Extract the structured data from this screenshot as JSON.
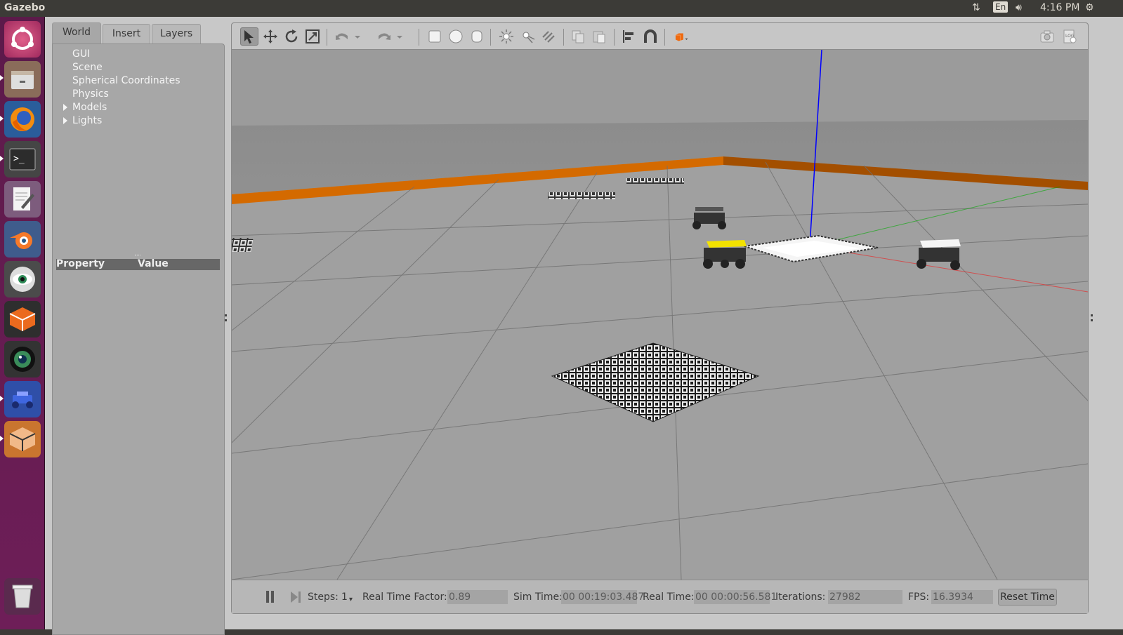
{
  "app": {
    "title": "Gazebo"
  },
  "indicators": {
    "keyboard": "En",
    "clock": "4:16 PM"
  },
  "launcher": {
    "items": [
      "ubuntu-dash",
      "files",
      "firefox",
      "terminal",
      "text-editor",
      "blender",
      "eye-app",
      "sketchup",
      "camera-app",
      "rover-app",
      "sketchup-2",
      "trash"
    ]
  },
  "left_panel": {
    "tabs": [
      {
        "label": "World",
        "active": true
      },
      {
        "label": "Insert",
        "active": false
      },
      {
        "label": "Layers",
        "active": false
      }
    ],
    "tree": [
      {
        "label": "GUI",
        "expandable": false
      },
      {
        "label": "Scene",
        "expandable": false
      },
      {
        "label": "Spherical Coordinates",
        "expandable": false
      },
      {
        "label": "Physics",
        "expandable": false
      },
      {
        "label": "Models",
        "expandable": true
      },
      {
        "label": "Lights",
        "expandable": true
      }
    ],
    "property_header": {
      "property": "Property",
      "value": "Value"
    }
  },
  "toolbar": {
    "tools": [
      "select-tool",
      "translate-tool",
      "rotate-tool",
      "scale-tool",
      "undo",
      "undo-dropdown",
      "redo",
      "redo-dropdown",
      "box-shape",
      "sphere-shape",
      "cylinder-shape",
      "point-light",
      "spot-light",
      "directional-light",
      "copy",
      "paste",
      "align",
      "snap",
      "view-angle",
      "screenshot",
      "log"
    ]
  },
  "status": {
    "steps_label": "Steps:",
    "steps_value": "1",
    "rtf_label": "Real Time Factor:",
    "rtf_value": "0.89",
    "sim_time_label": "Sim Time:",
    "sim_time_value": "00 00:19:03.487",
    "real_time_label": "Real Time:",
    "real_time_value": "00 00:00:56.581",
    "iterations_label": "Iterations:",
    "iterations_value": "27982",
    "fps_label": "FPS:",
    "fps_value": "16.3934",
    "reset_label": "Reset Time"
  },
  "colors": {
    "launcher_bg": "#6e1e58",
    "wall_orange": "#d46a00",
    "robot_highlight": "#f3e200",
    "axis_x": "#ff0000",
    "axis_y": "#00aa00",
    "axis_z": "#0000ff"
  }
}
